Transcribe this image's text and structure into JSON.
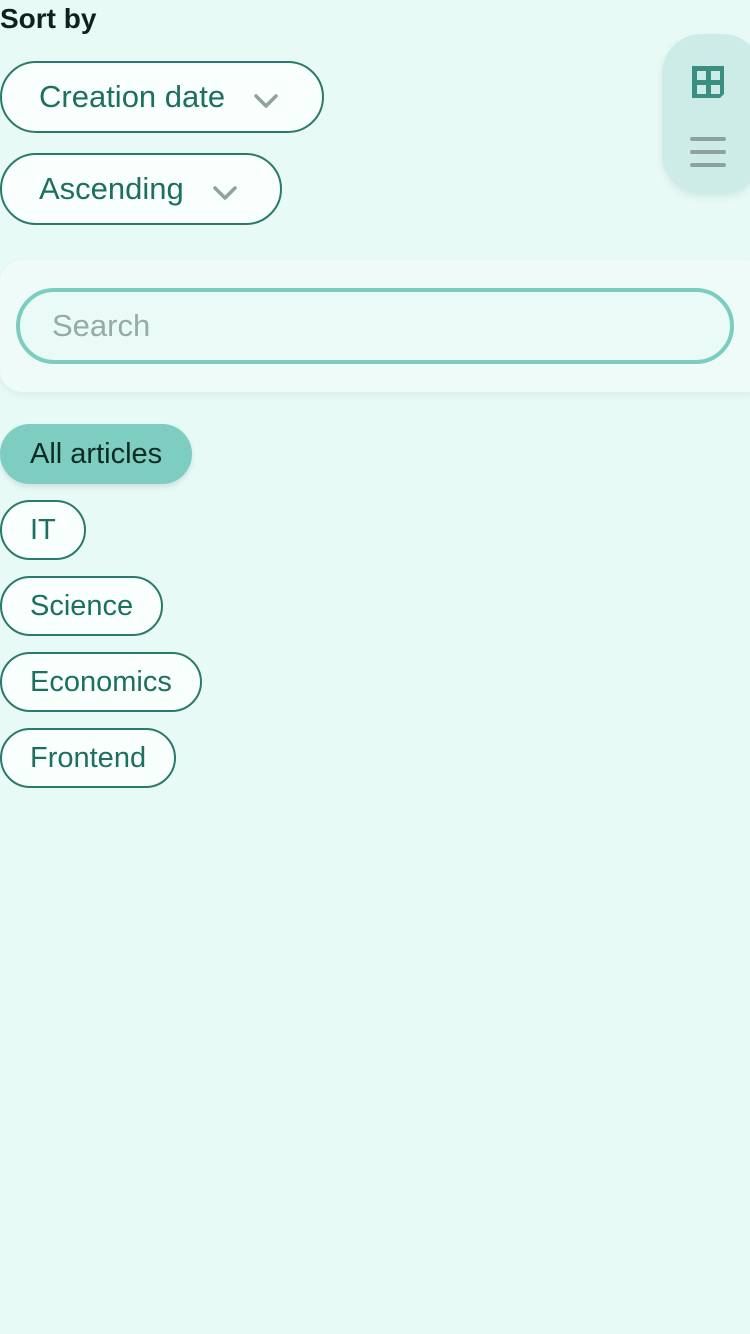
{
  "sort": {
    "label": "Sort by",
    "field_value": "Creation date",
    "order_value": "Ascending"
  },
  "view": {
    "grid_icon": "grid-icon",
    "list_icon": "list-icon",
    "active": "grid"
  },
  "search": {
    "placeholder": "Search",
    "value": ""
  },
  "tabs": [
    {
      "label": "All articles",
      "active": true
    },
    {
      "label": "IT",
      "active": false
    },
    {
      "label": "Science",
      "active": false
    },
    {
      "label": "Economics",
      "active": false
    },
    {
      "label": "Frontend",
      "active": false
    }
  ],
  "colors": {
    "background": "#e7faf6",
    "accent": "#2a7a6b",
    "active_tab": "#7dcdc1",
    "search_border": "#7cccc0"
  }
}
